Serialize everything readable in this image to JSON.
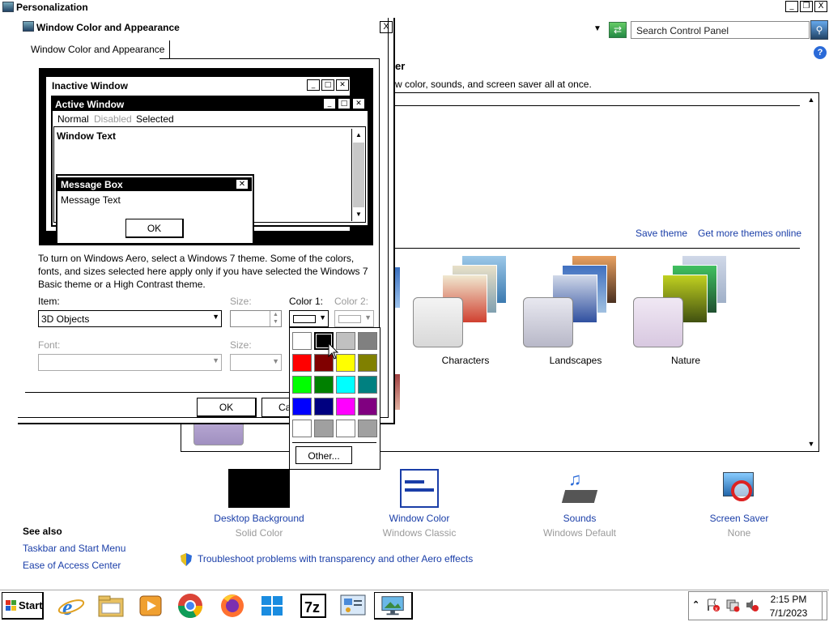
{
  "main_window": {
    "title": "Personalization",
    "controls": [
      "_",
      "❐",
      "X"
    ],
    "search_placeholder": "Search Control Panel",
    "heading_fragment": "er",
    "description_fragment": "w color, sounds, and screen saver all at once.",
    "save_theme": "Save theme",
    "get_more_themes": "Get more themes online",
    "themes": [
      {
        "label": "Characters"
      },
      {
        "label": "Landscapes"
      },
      {
        "label": "Nature"
      }
    ],
    "options": [
      {
        "label": "Desktop Background",
        "sublabel": "Solid Color",
        "icon": "solid-black-swatch"
      },
      {
        "label": "Window Color",
        "sublabel": "Windows Classic",
        "icon": "window-color-icon"
      },
      {
        "label": "Sounds",
        "sublabel": "Windows Default",
        "icon": "sounds-icon"
      },
      {
        "label": "Screen Saver",
        "sublabel": "None",
        "icon": "screen-saver-icon"
      }
    ],
    "see_also": {
      "heading": "See also",
      "links": [
        "Taskbar and Start Menu",
        "Ease of Access Center"
      ]
    },
    "troubleshoot_link": "Troubleshoot problems with transparency and other Aero effects"
  },
  "dialog": {
    "title": "Window Color and Appearance",
    "tab": "Window Color and Appearance",
    "close": "X",
    "preview": {
      "inactive_title": "Inactive Window",
      "active_title": "Active Window",
      "menu_normal": "Normal",
      "menu_disabled": "Disabled",
      "menu_selected": "Selected",
      "window_text": "Window Text",
      "message_box_title": "Message Box",
      "message_text": "Message Text",
      "ok": "OK"
    },
    "aero_note": "To turn on Windows Aero, select a Windows 7 theme.  Some of the colors, fonts, and sizes selected here apply only if you have selected the Windows 7 Basic theme or a High Contrast theme.",
    "item_label": "Item:",
    "item_value": "3D Objects",
    "size_label": "Size:",
    "color1_label": "Color 1:",
    "color2_label": "Color 2:",
    "font_label": "Font:",
    "size2_label": "Size:",
    "ok": "OK",
    "cancel_fragment": "Ca"
  },
  "color_picker": {
    "swatches": [
      "#ffffff",
      "#000000",
      "#c0c0c0",
      "#808080",
      "#ff0000",
      "#800000",
      "#ffff00",
      "#808000",
      "#00ff00",
      "#008000",
      "#00ffff",
      "#008080",
      "#0000ff",
      "#000080",
      "#ff00ff",
      "#800080",
      "#ffffff",
      "#a0a0a0",
      "#ffffff",
      "#a0a0a0"
    ],
    "selected_index": 1,
    "other": "Other..."
  },
  "taskbar": {
    "start": "Start",
    "apps": [
      "internet-explorer-icon",
      "file-explorer-icon",
      "media-player-icon",
      "chrome-icon",
      "firefox-icon",
      "windows-icon",
      "7zip-icon",
      "control-panel-icon",
      "personalization-icon"
    ],
    "time": "2:15 PM",
    "date": "7/1/2023"
  },
  "colors": {
    "link": "#1a3ea8",
    "disabled": "#9a9a9a"
  }
}
